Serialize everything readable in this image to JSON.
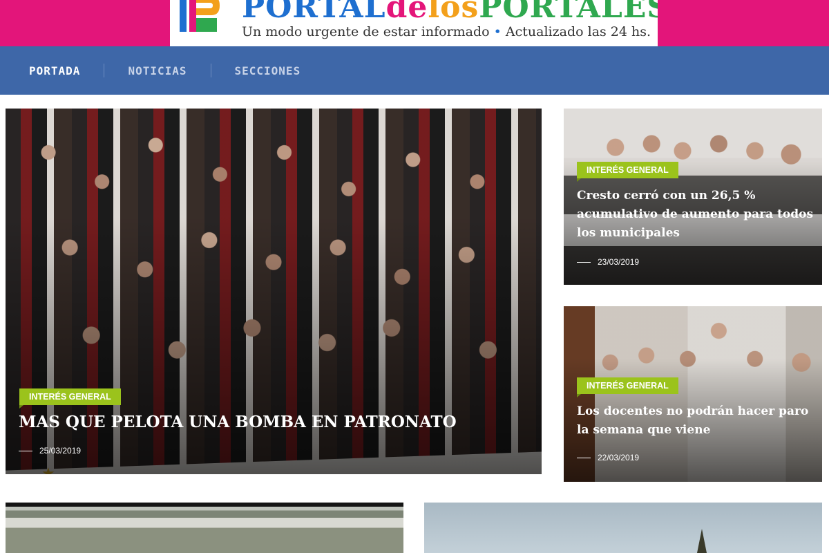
{
  "site": {
    "logo_text_parts": [
      "PORTAL",
      "de",
      "los",
      "PORTALES"
    ],
    "tagline_left": "Un modo urgente de estar informado",
    "tagline_dot": "•",
    "tagline_right": "Actualizado las 24 hs."
  },
  "nav": {
    "items": [
      {
        "label": "PORTADA",
        "active": true
      },
      {
        "label": "NOTICIAS",
        "active": false
      },
      {
        "label": "SECCIONES",
        "active": false
      }
    ]
  },
  "featured": {
    "category": "INTERÉS GENERAL",
    "title": "MAS QUE PELOTA UNA BOMBA EN PATRONATO",
    "date": "25/03/2019"
  },
  "side_articles": [
    {
      "category": "INTERÉS GENERAL",
      "title": "Cresto cerró con un 26,5 % acumulativo de aumento para todos los municipales",
      "date": "23/03/2019"
    },
    {
      "category": "INTERÉS GENERAL",
      "title": "Los docentes no podrán hacer paro la semana que viene",
      "date": "22/03/2019"
    }
  ],
  "colors": {
    "header_pink": "#e3157a",
    "nav_blue": "#3e67a8",
    "badge_green": "#9bc31c"
  }
}
